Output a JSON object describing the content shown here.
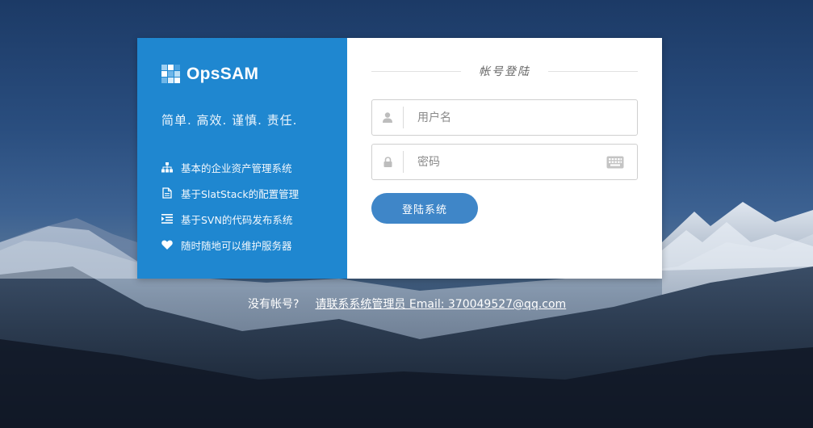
{
  "brand": {
    "name": "OpsSAM",
    "slogan": "简单. 高效. 谨慎. 责任."
  },
  "features": [
    {
      "icon": "sitemap-icon",
      "label": "基本的企业资产管理系统"
    },
    {
      "icon": "file-icon",
      "label": "基于SlatStack的配置管理"
    },
    {
      "icon": "indent-icon",
      "label": "基于SVN的代码发布系统"
    },
    {
      "icon": "heart-icon",
      "label": "随时随地可以维护服务器"
    }
  ],
  "login": {
    "title": "帐号登陆",
    "username": {
      "placeholder": "用户名",
      "value": "",
      "icon": "user-icon"
    },
    "password": {
      "placeholder": "密码",
      "value": "",
      "icon": "lock-icon",
      "extra_icon": "keyboard-icon"
    },
    "submit_label": "登陆系统"
  },
  "footer": {
    "question": "没有帐号?",
    "contact_link": "请联系系统管理员 Email: 370049527@qq.com"
  },
  "colors": {
    "brand_panel": "#1f87d0",
    "button": "#3f86c8",
    "card_bg": "#ffffff"
  }
}
